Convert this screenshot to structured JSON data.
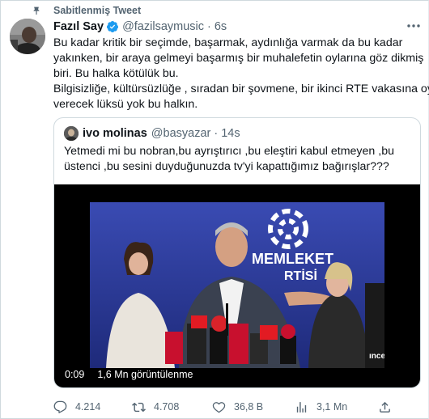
{
  "pinned": {
    "label": "Sabitlenmiş Tweet",
    "icon": "pin-icon"
  },
  "author": {
    "name": "Fazıl Say",
    "handle": "@fazilsaymusic",
    "separator": "·",
    "time": "6s",
    "verified": true
  },
  "tweet": {
    "lines": [
      "Bu kadar kritik bir seçimde, başarmak, aydınlığa varmak da bu kadar",
      "yakınken, bir araya gelmeyi başarmış bir muhalefetin oylarına göz dikmiş",
      "biri. Bu halka kötülük bu.",
      "Bilgisizliğe, kültürsüzlüğe , sıradan bir şovmene, bir ikinci RTE vakasına oy",
      "verecek lüksü yok bu halkın."
    ]
  },
  "quote": {
    "name": "ivo molinas",
    "handle": "@basyazar",
    "separator": "·",
    "time": "14s",
    "lines": [
      "Yetmedi mi bu nobran,bu ayrıştırıcı ,bu eleştiri kabul etmeyen ,bu",
      "üstenci ,bu sesini duyduğunuzda tv'yi kapattığımız bağırışlar???"
    ],
    "video": {
      "duration": "0:09",
      "views": "1,6 Mn görüntülenme",
      "backdrop_text_1": "MEMLEKET",
      "backdrop_text_2": "RTİSİ",
      "watermark": "ınce"
    }
  },
  "actions": {
    "replies": "4.214",
    "retweets": "4.708",
    "likes": "36,8 B",
    "views": "3,1 Mn"
  },
  "colors": {
    "text": "#0f1419",
    "secondary": "#536471",
    "verified": "#1d9bf0",
    "border": "#cfd9de"
  }
}
